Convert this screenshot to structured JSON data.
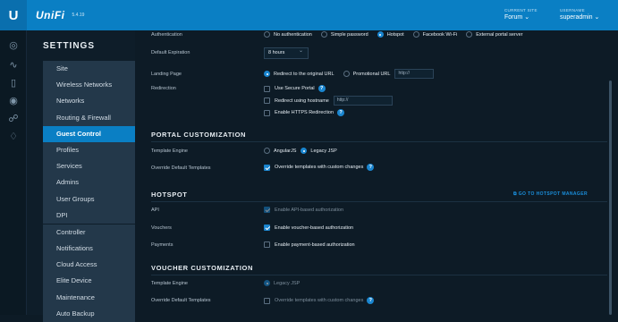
{
  "topbar": {
    "brand": "UniFi",
    "version": "5.4.19",
    "site_label": "CURRENT SITE",
    "site_value": "Forum",
    "user_label": "USERNAME",
    "user_value": "superadmin"
  },
  "rail_icons": [
    "dashboard-icon",
    "statistics-icon",
    "map-icon",
    "devices-icon",
    "clients-icon",
    "insights-icon"
  ],
  "sidebar": {
    "title": "SETTINGS",
    "group1": [
      "Site",
      "Wireless Networks",
      "Networks",
      "Routing & Firewall",
      "Guest Control",
      "Profiles",
      "Services",
      "Admins",
      "User Groups",
      "DPI"
    ],
    "group2": [
      "Controller",
      "Notifications",
      "Cloud Access",
      "Elite Device",
      "Maintenance",
      "Auto Backup"
    ],
    "active": "Guest Control"
  },
  "guest_policies": {
    "authentication_label": "Authentication",
    "auth_options": [
      "No authentication",
      "Simple password",
      "Hotspot",
      "Facebook Wi-Fi",
      "External portal server"
    ],
    "auth_selected": "Hotspot",
    "default_expiration_label": "Default Expiration",
    "default_expiration_value": "8 hours",
    "landing_page_label": "Landing Page",
    "landing_redirect": "Redirect to the original URL",
    "landing_promotional": "Promotional URL",
    "promotional_placeholder": "http://",
    "redirection_label": "Redirection",
    "use_secure_portal": "Use Secure Portal",
    "redirect_hostname": "Redirect using hostname",
    "hostname_placeholder": "http://",
    "enable_https": "Enable HTTPS Redirection"
  },
  "portal_customization": {
    "title": "PORTAL CUSTOMIZATION",
    "template_engine_label": "Template Engine",
    "engine_options": [
      "AngularJS",
      "Legacy JSP"
    ],
    "engine_selected": "Legacy JSP",
    "override_label": "Override Default Templates",
    "override_text": "Override templates with custom changes"
  },
  "hotspot": {
    "title": "HOTSPOT",
    "manager_link": "GO TO HOTSPOT MANAGER",
    "api_label": "API",
    "api_text": "Enable API-based authorization",
    "vouchers_label": "Vouchers",
    "vouchers_text": "Enable voucher-based authorization",
    "payments_label": "Payments",
    "payments_text": "Enable payment-based authorization"
  },
  "voucher_customization": {
    "title": "VOUCHER CUSTOMIZATION",
    "template_engine_label": "Template Engine",
    "engine_value": "Legacy JSP",
    "override_label": "Override Default Templates",
    "override_text": "Override templates with custom changes"
  },
  "colors": {
    "accent": "#0a7fc4",
    "background": "#0d1b26",
    "sidebar_group": "#23384a"
  }
}
